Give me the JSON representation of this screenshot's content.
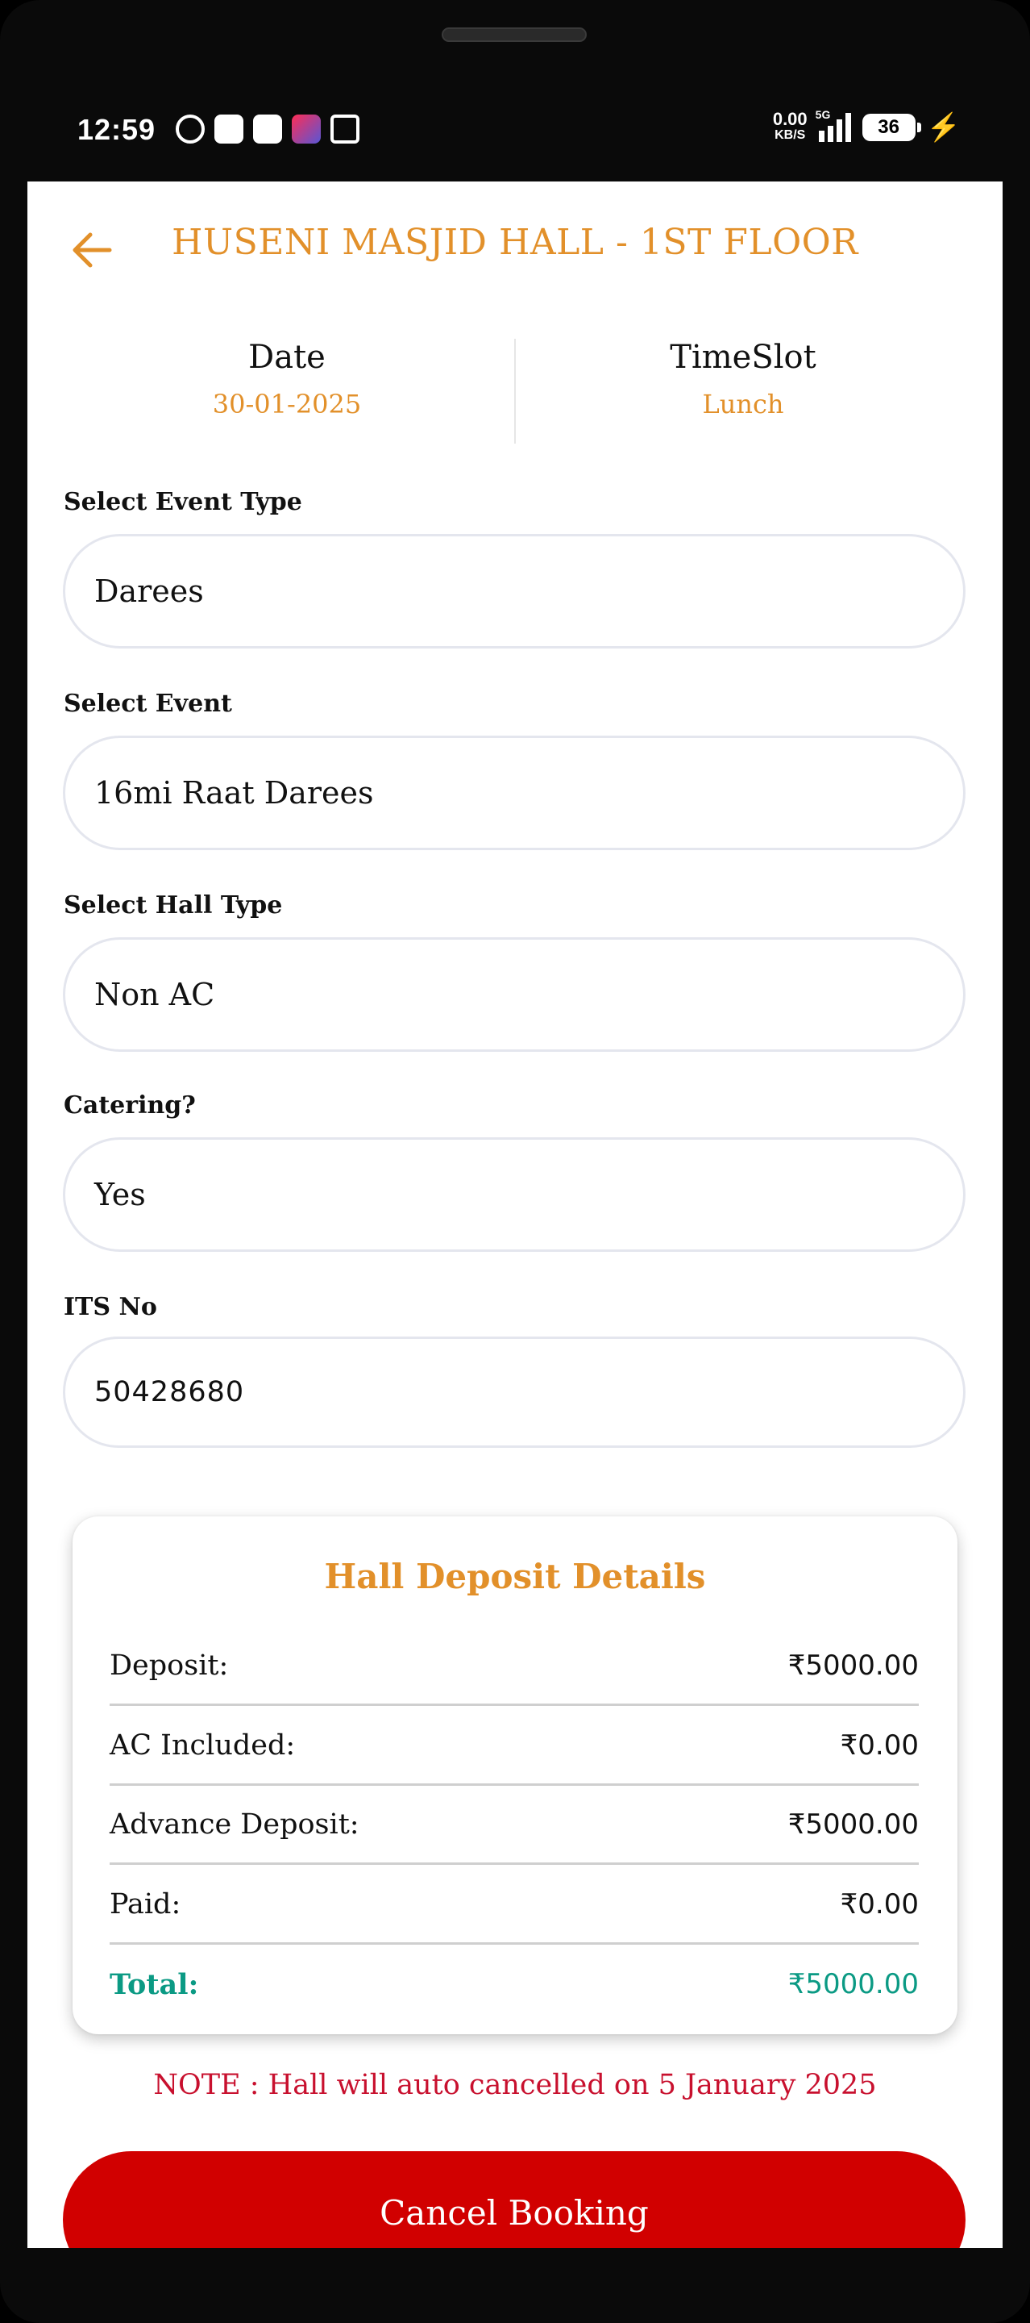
{
  "status_bar": {
    "time": "12:59",
    "net_speed": "0.00",
    "net_unit": "KB/S",
    "network": "5G",
    "battery": "36"
  },
  "header": {
    "title": "HUSENI MASJID HALL - 1ST FLOOR",
    "back_icon": "arrow-left-icon"
  },
  "info": {
    "date_label": "Date",
    "date_value": "30-01-2025",
    "timeslot_label": "TimeSlot",
    "timeslot_value": "Lunch"
  },
  "form": {
    "event_type_label": "Select Event Type",
    "event_type_value": "Darees",
    "event_label": "Select Event",
    "event_value": "16mi Raat Darees",
    "hall_type_label": "Select Hall Type",
    "hall_type_value": "Non AC",
    "catering_label": "Catering?",
    "catering_value": "Yes",
    "its_label": "ITS No",
    "its_value": "50428680"
  },
  "deposit": {
    "title": "Hall Deposit Details",
    "rows": [
      {
        "label": "Deposit:",
        "amount": "₹5000.00"
      },
      {
        "label": "AC Included:",
        "amount": "₹0.00"
      },
      {
        "label": "Advance Deposit:",
        "amount": "₹5000.00"
      },
      {
        "label": "Paid:",
        "amount": "₹0.00"
      }
    ],
    "total_label": "Total:",
    "total_amount": "₹5000.00"
  },
  "note": "NOTE : Hall will auto cancelled on 5 January 2025",
  "cancel_button": "Cancel Booking",
  "colors": {
    "accent": "#e2902a",
    "total": "#0b9a84",
    "note": "#c8102e",
    "button": "#d10000"
  }
}
